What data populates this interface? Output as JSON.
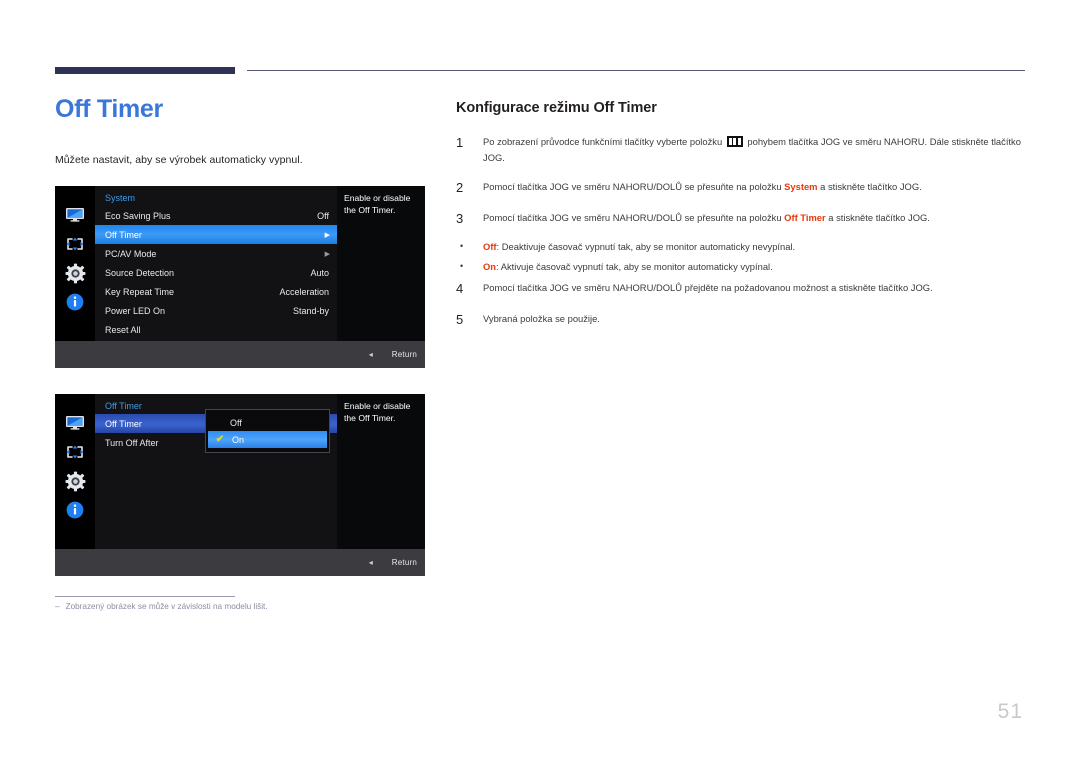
{
  "document": {
    "page_number": "51"
  },
  "left": {
    "title": "Off Timer",
    "intro": "Můžete nastavit, aby se výrobek automaticky vypnul.",
    "footnote_dash": "–",
    "footnote": "Zobrazený obrázek se může v závislosti na modelu lišit."
  },
  "osd1": {
    "header": "System",
    "rows": [
      {
        "label": "Eco Saving Plus",
        "value": "Off",
        "arrow": "",
        "selected": false
      },
      {
        "label": "Off Timer",
        "value": "",
        "arrow": "▶",
        "selected": true
      },
      {
        "label": "PC/AV Mode",
        "value": "",
        "arrow": "▶",
        "selected": false
      },
      {
        "label": "Source Detection",
        "value": "Auto",
        "arrow": "",
        "selected": false
      },
      {
        "label": "Key Repeat Time",
        "value": "Acceleration",
        "arrow": "",
        "selected": false
      },
      {
        "label": "Power LED On",
        "value": "Stand-by",
        "arrow": "",
        "selected": false
      },
      {
        "label": "Reset All",
        "value": "",
        "arrow": "",
        "selected": false
      }
    ],
    "description": "Enable or disable the Off Timer.",
    "footer_back": "◂",
    "footer_return": "Return",
    "icons": [
      "monitor-icon",
      "screen-adjust-icon",
      "gear-icon",
      "info-icon"
    ]
  },
  "osd2": {
    "header": "Off Timer",
    "rows": [
      {
        "label": "Off Timer",
        "value": "",
        "arrow": "",
        "selected": true
      },
      {
        "label": "Turn Off After",
        "value": "",
        "arrow": "",
        "selected": false
      }
    ],
    "dropdown": [
      {
        "label": "Off",
        "checked": false,
        "selected": false
      },
      {
        "label": "On",
        "checked": true,
        "selected": true
      }
    ],
    "check_glyph": "✔",
    "description": "Enable or disable the Off Timer.",
    "footer_back": "◂",
    "footer_return": "Return",
    "icons": [
      "monitor-icon",
      "screen-adjust-icon",
      "gear-icon",
      "info-icon"
    ]
  },
  "right": {
    "section_title": "Konfigurace režimu Off Timer",
    "steps": [
      {
        "num": "1",
        "parts": [
          {
            "t": "Po zobrazení průvodce funkčními tlačítky vyberte položku "
          },
          {
            "glyph": "menu-icon"
          },
          {
            "t": " pohybem tlačítka JOG ve směru NAHORU. Dále stiskněte tlačítko JOG."
          }
        ]
      },
      {
        "num": "2",
        "parts": [
          {
            "t": "Pomocí tlačítka JOG ve směru NAHORU/DOLŮ se přesuňte na položku "
          },
          {
            "t": "System",
            "hl": true
          },
          {
            "t": " a stiskněte tlačítko JOG."
          }
        ]
      },
      {
        "num": "3",
        "parts": [
          {
            "t": "Pomocí tlačítka JOG ve směru NAHORU/DOLŮ se přesuňte na položku "
          },
          {
            "t": "Off Timer",
            "hl": true
          },
          {
            "t": " a stiskněte tlačítko JOG."
          }
        ]
      }
    ],
    "bullets": [
      {
        "dot": "•",
        "parts": [
          {
            "t": "Off",
            "hl": true
          },
          {
            "t": ": Deaktivuje časovač vypnutí tak, aby se monitor automaticky nevypínal."
          }
        ]
      },
      {
        "dot": "•",
        "parts": [
          {
            "t": "On",
            "hl": true
          },
          {
            "t": ": Aktivuje časovač vypnutí tak, aby se monitor automaticky vypínal."
          }
        ]
      }
    ],
    "steps_after": [
      {
        "num": "4",
        "parts": [
          {
            "t": "Pomocí tlačítka JOG ve směru NAHORU/DOLŮ přejděte na požadovanou možnost a stiskněte tlačítko JOG."
          }
        ]
      },
      {
        "num": "5",
        "parts": [
          {
            "t": "Vybraná položka se použije."
          }
        ]
      }
    ]
  },
  "colors": {
    "accent_blue": "#3a77d9",
    "rule_navy": "#2e3356",
    "highlight_red": "#e8380d",
    "osd_highlight": "#3d9bf7",
    "osd_header_blue": "#3f9be8",
    "check_yellow": "#d9e022"
  }
}
